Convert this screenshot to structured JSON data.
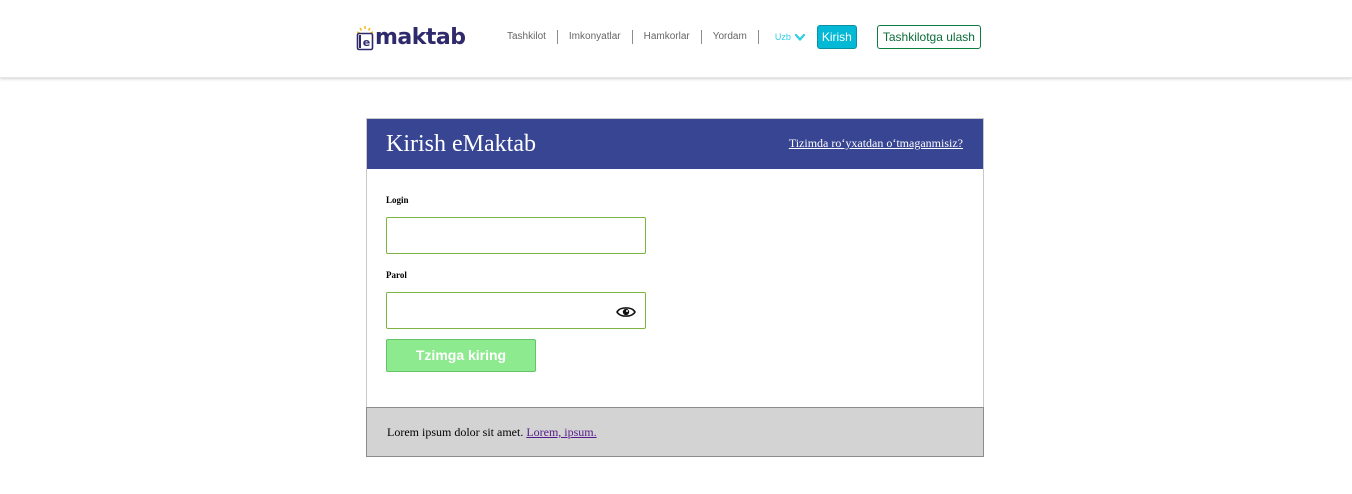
{
  "header": {
    "logo_text": "maktab",
    "nav_items": [
      "Tashkilot",
      "Imkonyatlar",
      "Hamkorlar",
      "Yordam"
    ],
    "language": "Uzb",
    "login_button": "Kirish",
    "org_button": "Tashkilotga ulash"
  },
  "login_card": {
    "title": "Kirish eMaktab",
    "register_link": "Tizimda ro‘yxatdan o‘tmaganmisiz?",
    "login_label": "Login",
    "login_value": "",
    "password_label": "Parol",
    "password_value": "",
    "submit_label": "Tzimga kiring"
  },
  "footer": {
    "text": "Lorem ipsum dolor sit amet.",
    "link_text": "Lorem, ipsum."
  },
  "colors": {
    "brand_blue": "#374593",
    "accent_cyan": "#04b9d6",
    "org_green": "#0b7d3e",
    "submit_green": "#8eea8e",
    "input_border": "#7cb342",
    "footer_gray": "#d3d3d3"
  },
  "icons": {
    "logo": "emaktab-book-logo-icon",
    "language_dropdown": "chevron-down-icon",
    "password_toggle": "eye-icon"
  }
}
